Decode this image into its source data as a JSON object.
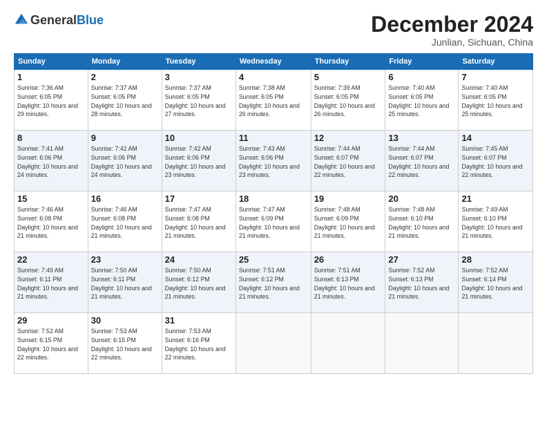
{
  "header": {
    "logo_general": "General",
    "logo_blue": "Blue",
    "title": "December 2024",
    "location": "Junlian, Sichuan, China"
  },
  "weekdays": [
    "Sunday",
    "Monday",
    "Tuesday",
    "Wednesday",
    "Thursday",
    "Friday",
    "Saturday"
  ],
  "weeks": [
    [
      {
        "day": "1",
        "sunrise": "7:36 AM",
        "sunset": "6:05 PM",
        "daylight": "10 hours and 29 minutes."
      },
      {
        "day": "2",
        "sunrise": "7:37 AM",
        "sunset": "6:05 PM",
        "daylight": "10 hours and 28 minutes."
      },
      {
        "day": "3",
        "sunrise": "7:37 AM",
        "sunset": "6:05 PM",
        "daylight": "10 hours and 27 minutes."
      },
      {
        "day": "4",
        "sunrise": "7:38 AM",
        "sunset": "6:05 PM",
        "daylight": "10 hours and 26 minutes."
      },
      {
        "day": "5",
        "sunrise": "7:39 AM",
        "sunset": "6:05 PM",
        "daylight": "10 hours and 26 minutes."
      },
      {
        "day": "6",
        "sunrise": "7:40 AM",
        "sunset": "6:05 PM",
        "daylight": "10 hours and 25 minutes."
      },
      {
        "day": "7",
        "sunrise": "7:40 AM",
        "sunset": "6:05 PM",
        "daylight": "10 hours and 25 minutes."
      }
    ],
    [
      {
        "day": "8",
        "sunrise": "7:41 AM",
        "sunset": "6:06 PM",
        "daylight": "10 hours and 24 minutes."
      },
      {
        "day": "9",
        "sunrise": "7:42 AM",
        "sunset": "6:06 PM",
        "daylight": "10 hours and 24 minutes."
      },
      {
        "day": "10",
        "sunrise": "7:42 AM",
        "sunset": "6:06 PM",
        "daylight": "10 hours and 23 minutes."
      },
      {
        "day": "11",
        "sunrise": "7:43 AM",
        "sunset": "6:06 PM",
        "daylight": "10 hours and 23 minutes."
      },
      {
        "day": "12",
        "sunrise": "7:44 AM",
        "sunset": "6:07 PM",
        "daylight": "10 hours and 22 minutes."
      },
      {
        "day": "13",
        "sunrise": "7:44 AM",
        "sunset": "6:07 PM",
        "daylight": "10 hours and 22 minutes."
      },
      {
        "day": "14",
        "sunrise": "7:45 AM",
        "sunset": "6:07 PM",
        "daylight": "10 hours and 22 minutes."
      }
    ],
    [
      {
        "day": "15",
        "sunrise": "7:46 AM",
        "sunset": "6:08 PM",
        "daylight": "10 hours and 21 minutes."
      },
      {
        "day": "16",
        "sunrise": "7:46 AM",
        "sunset": "6:08 PM",
        "daylight": "10 hours and 21 minutes."
      },
      {
        "day": "17",
        "sunrise": "7:47 AM",
        "sunset": "6:08 PM",
        "daylight": "10 hours and 21 minutes."
      },
      {
        "day": "18",
        "sunrise": "7:47 AM",
        "sunset": "6:09 PM",
        "daylight": "10 hours and 21 minutes."
      },
      {
        "day": "19",
        "sunrise": "7:48 AM",
        "sunset": "6:09 PM",
        "daylight": "10 hours and 21 minutes."
      },
      {
        "day": "20",
        "sunrise": "7:48 AM",
        "sunset": "6:10 PM",
        "daylight": "10 hours and 21 minutes."
      },
      {
        "day": "21",
        "sunrise": "7:49 AM",
        "sunset": "6:10 PM",
        "daylight": "10 hours and 21 minutes."
      }
    ],
    [
      {
        "day": "22",
        "sunrise": "7:49 AM",
        "sunset": "6:11 PM",
        "daylight": "10 hours and 21 minutes."
      },
      {
        "day": "23",
        "sunrise": "7:50 AM",
        "sunset": "6:11 PM",
        "daylight": "10 hours and 21 minutes."
      },
      {
        "day": "24",
        "sunrise": "7:50 AM",
        "sunset": "6:12 PM",
        "daylight": "10 hours and 21 minutes."
      },
      {
        "day": "25",
        "sunrise": "7:51 AM",
        "sunset": "6:12 PM",
        "daylight": "10 hours and 21 minutes."
      },
      {
        "day": "26",
        "sunrise": "7:51 AM",
        "sunset": "6:13 PM",
        "daylight": "10 hours and 21 minutes."
      },
      {
        "day": "27",
        "sunrise": "7:52 AM",
        "sunset": "6:13 PM",
        "daylight": "10 hours and 21 minutes."
      },
      {
        "day": "28",
        "sunrise": "7:52 AM",
        "sunset": "6:14 PM",
        "daylight": "10 hours and 21 minutes."
      }
    ],
    [
      {
        "day": "29",
        "sunrise": "7:52 AM",
        "sunset": "6:15 PM",
        "daylight": "10 hours and 22 minutes."
      },
      {
        "day": "30",
        "sunrise": "7:53 AM",
        "sunset": "6:15 PM",
        "daylight": "10 hours and 22 minutes."
      },
      {
        "day": "31",
        "sunrise": "7:53 AM",
        "sunset": "6:16 PM",
        "daylight": "10 hours and 22 minutes."
      },
      null,
      null,
      null,
      null
    ]
  ]
}
